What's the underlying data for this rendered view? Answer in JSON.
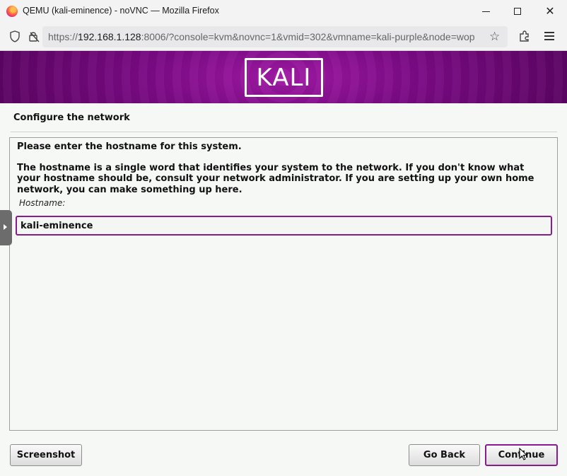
{
  "window": {
    "title": "QEMU (kali-eminence) - noVNC — Mozilla Firefox",
    "minimize_icon": "minimize-icon",
    "maximize_icon": "maximize-icon",
    "close_icon": "close-icon"
  },
  "navbar": {
    "url_prefix": "https://",
    "url_host": "192.168.1.128",
    "url_rest": ":8006/?console=kvm&novnc=1&vmid=302&vmname=kali-purple&node=wop",
    "icons": [
      "shield-icon",
      "lock-icon",
      "star-icon",
      "extensions-icon",
      "menu-icon"
    ]
  },
  "installer": {
    "logo_text": "KALI",
    "section_title": "Configure the network",
    "prompt": "Please enter the hostname for this system.",
    "description": "The hostname is a single word that identifies your system to the network. If you don't know what your hostname should be, consult your network administrator. If you are setting up your own home network, you can make something up here.",
    "field_label": "Hostname:",
    "hostname_value": "kali-eminence",
    "buttons": {
      "screenshot": "Screenshot",
      "go_back": "Go Back",
      "continue": "Continue"
    }
  },
  "colors": {
    "accent": "#8a1b8e",
    "banner": "#7b0a85"
  }
}
